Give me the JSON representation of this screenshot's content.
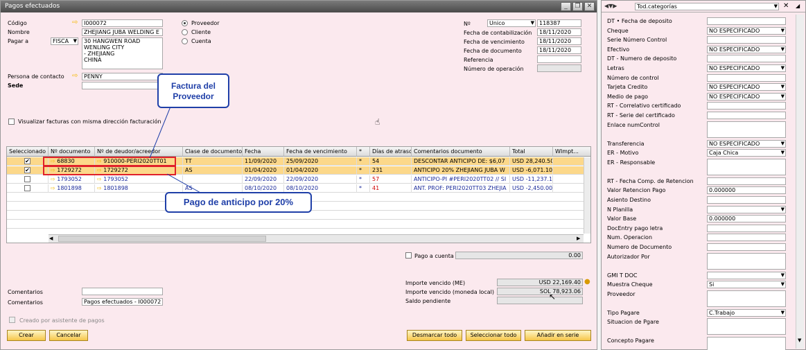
{
  "window": {
    "title": "Pagos efectuados",
    "min": "_",
    "restore": "❐",
    "close": "✕"
  },
  "header": {
    "codigo_label": "Código",
    "codigo_value": "I000072",
    "nombre_label": "Nombre",
    "nombre_value": "ZHEJIANG JUBA WELDING E",
    "pagar_a_label": "Pagar a",
    "pagar_a_select": "FISCA",
    "address_lines": [
      "30 HANGWEN ROAD",
      "WENLING CITY",
      "-  ZHEJIANG",
      "CHINA"
    ],
    "contacto_label": "Persona de contacto",
    "contacto_value": "PENNY",
    "sede_label": "Sede",
    "radio_proveedor": "Proveedor",
    "radio_cliente": "Cliente",
    "radio_cuenta": "Cuenta",
    "visualizar_label": "Visualizar facturas con misma dirección facturación"
  },
  "right_header": {
    "no_label": "Nº",
    "no_series": "Unico",
    "no_value": "118387",
    "fecha_contab_label": "Fecha de contabilización",
    "fecha_contab": "18/11/2020",
    "fecha_venc_label": "Fecha de vencimiento",
    "fecha_venc": "18/11/2020",
    "fecha_doc_label": "Fecha de documento",
    "fecha_doc": "18/11/2020",
    "referencia_label": "Referencia",
    "num_op_label": "Número de operación"
  },
  "table": {
    "headers": [
      "Seleccionado",
      "Nº documento",
      "Nº de deudor/acreedor",
      "Clase de documento",
      "Fecha",
      "Fecha de vencimiento",
      "*",
      "Días de atraso",
      "Comentarios documento",
      "Total",
      "WImpt..."
    ],
    "rows": [
      {
        "checked": "✔",
        "doc": "68830",
        "deudor": "910000-PERI2020TT01",
        "clase": "TT",
        "fecha": "11/09/2020",
        "venc": "25/09/2020",
        "star": "*",
        "dias": "54",
        "coment": "DESCONTAR ANTICIPO DE: $6,07",
        "total": "USD 28,240.50"
      },
      {
        "checked": "✔",
        "doc": "1729272",
        "deudor": "1729272",
        "clase": "AS",
        "fecha": "01/04/2020",
        "venc": "01/04/2020",
        "star": "*",
        "dias": "231",
        "coment": "ANTICIPO 20% ZHEJIANG JUBA W",
        "total": "USD -6,071.10"
      },
      {
        "checked": "",
        "doc": "1793052",
        "deudor": "1793052",
        "clase": "",
        "fecha": "22/09/2020",
        "venc": "22/09/2020",
        "star": "*",
        "dias": "57",
        "coment": "ANTICIPO-PI #PERI2020TT02 // SI",
        "total": "USD -11,237.10"
      },
      {
        "checked": "",
        "doc": "1801898",
        "deudor": "1801898",
        "clase": "AS",
        "fecha": "08/10/2020",
        "venc": "08/10/2020",
        "star": "*",
        "dias": "41",
        "coment": "ANT. PROF: PERI2020TT03 ZHEJIA",
        "total": "USD -2,450.00"
      }
    ]
  },
  "callouts": {
    "factura": "Factura del Proveedor",
    "anticipo": "Pago de anticipo por 20%"
  },
  "footer": {
    "pago_cuenta_label": "Pago a cuenta",
    "pago_cuenta_value": "0.00",
    "importe_me_label": "Importe vencido (ME)",
    "importe_me": "USD 22,169.40",
    "importe_ml_label": "Importe vencido (moneda local)",
    "importe_ml": "SOL 78,923.06",
    "saldo_label": "Saldo pendiente",
    "comentarios1_label": "Comentarios",
    "comentarios2_label": "Comentarios",
    "comentarios2_value": "Pagos efectuados - I000072",
    "creado_label": "Creado por asistente de pagos",
    "btn_crear": "Crear",
    "btn_cancelar": "Cancelar",
    "btn_desmarcar": "Desmarcar todo",
    "btn_seleccionar": "Seleccionar todo",
    "btn_serie": "Añadir en serie"
  },
  "side": {
    "category": "Tod.categorías",
    "fields": [
      {
        "label": "DT • Fecha de deposito",
        "value": "",
        "type": "input"
      },
      {
        "label": "Cheque",
        "value": "NO ESPECIFICADO",
        "type": "select"
      },
      {
        "label": "Serie Número Control",
        "value": "",
        "type": "input"
      },
      {
        "label": "Efectivo",
        "value": "NO ESPECIFICADO",
        "type": "select"
      },
      {
        "label": "DT - Numero de deposito",
        "value": "",
        "type": "input"
      },
      {
        "label": "Letras",
        "value": "NO ESPECIFICADO",
        "type": "select"
      },
      {
        "label": "Número de control",
        "value": "",
        "type": "input"
      },
      {
        "label": "Tarjeta Credito",
        "value": "NO ESPECIFICADO",
        "type": "select"
      },
      {
        "label": "Medio de pago",
        "value": "NO ESPECIFICADO",
        "type": "select"
      },
      {
        "label": "RT - Correlativo certificado",
        "value": "",
        "type": "input"
      },
      {
        "label": "RT - Serie del certificado",
        "value": "",
        "type": "input"
      },
      {
        "label": "Enlace numControl",
        "value": "",
        "type": "tall"
      },
      {
        "label": "Transferencia",
        "value": "NO ESPECIFICADO",
        "type": "select"
      },
      {
        "label": "ER - Motivo",
        "value": "Caja Chica",
        "type": "select"
      },
      {
        "label": "ER - Responsable",
        "value": "",
        "type": "tall"
      },
      {
        "label": "RT - Fecha Comp. de Retencion",
        "value": "",
        "type": "input"
      },
      {
        "label": "Valor Retencion Pago",
        "value": "0.000000",
        "type": "input"
      },
      {
        "label": "Asiento Destino",
        "value": "",
        "type": "input"
      },
      {
        "label": "N Planilla",
        "value": "",
        "type": "select"
      },
      {
        "label": "Valor Base",
        "value": "0.000000",
        "type": "input"
      },
      {
        "label": "DocEntry pago letra",
        "value": "",
        "type": "input"
      },
      {
        "label": "Num. Operacion",
        "value": "",
        "type": "input"
      },
      {
        "label": "Numero de Documento",
        "value": "",
        "type": "input"
      },
      {
        "label": "Autorizador Por",
        "value": "",
        "type": "tall"
      },
      {
        "label": "GMI  T  DOC",
        "value": "",
        "type": "select"
      },
      {
        "label": "Muestra Cheque",
        "value": "Si",
        "type": "select"
      },
      {
        "label": "Proveedor",
        "value": "",
        "type": "tall"
      },
      {
        "label": "Tipo Pagare",
        "value": "C.Trabajo",
        "type": "select"
      },
      {
        "label": "Situacion de Pgare",
        "value": "",
        "type": "tall"
      },
      {
        "label": "Concepto Pagare",
        "value": "",
        "type": "tall"
      }
    ]
  }
}
